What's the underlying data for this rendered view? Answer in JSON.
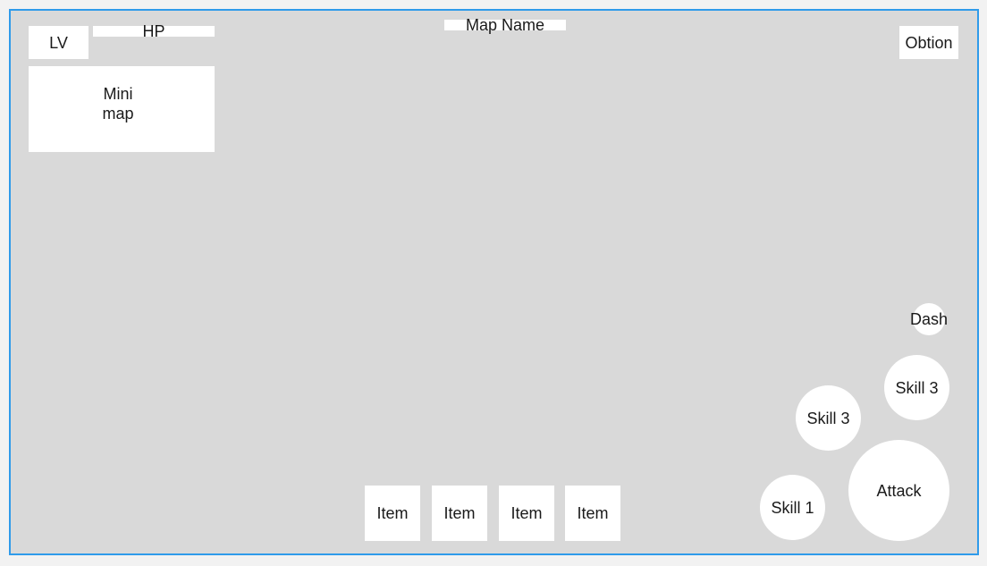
{
  "hud": {
    "level_label": "LV",
    "hp_label": "HP",
    "minimap_label": "Mini\nmap",
    "map_name": "Map Name",
    "option_label": "Obtion"
  },
  "items": [
    {
      "label": "Item"
    },
    {
      "label": "Item"
    },
    {
      "label": "Item"
    },
    {
      "label": "Item"
    }
  ],
  "actions": {
    "dash": "Dash",
    "skill_top": "Skill 3",
    "skill_mid": "Skill 3",
    "attack": "Attack",
    "skill_bottom": "Skill 1"
  },
  "colors": {
    "background": "#d9d9d9",
    "frame_border": "#2f9bea",
    "panel": "#ffffff"
  }
}
